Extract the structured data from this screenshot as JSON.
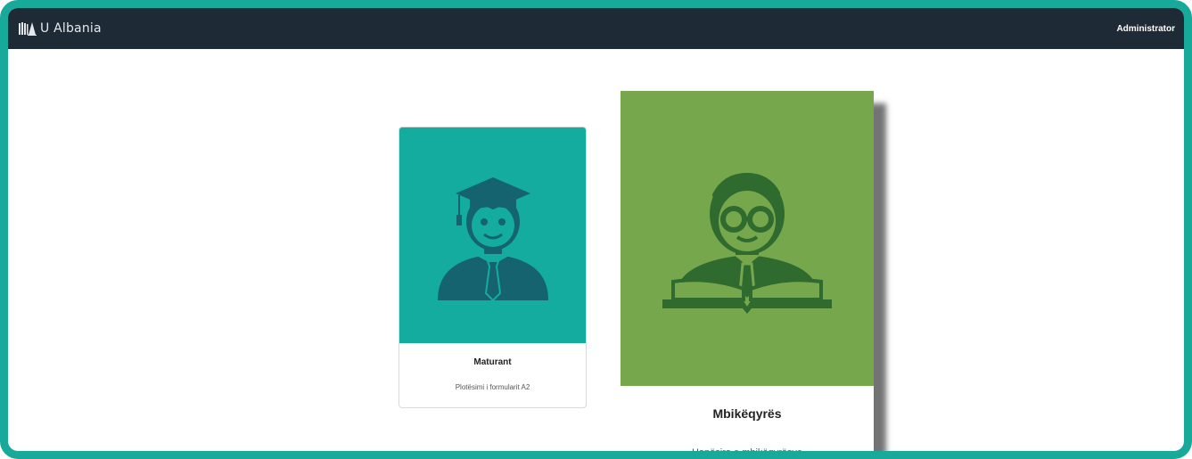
{
  "app": {
    "brand_name": "U Albania",
    "user_label": "Administrator"
  },
  "cards": [
    {
      "title": "Maturant",
      "subtitle": "Plotësimi i formularit A2",
      "color": "#15aca0",
      "icon": "graduate-student-icon"
    },
    {
      "title": "Mbikëqyrës",
      "subtitle": "Hapësira e mbikëqyrësve",
      "color": "#77a74c",
      "icon": "reader-supervisor-icon"
    }
  ],
  "colors": {
    "navbar": "#1e2a35",
    "frame_border": "#17a99a"
  }
}
